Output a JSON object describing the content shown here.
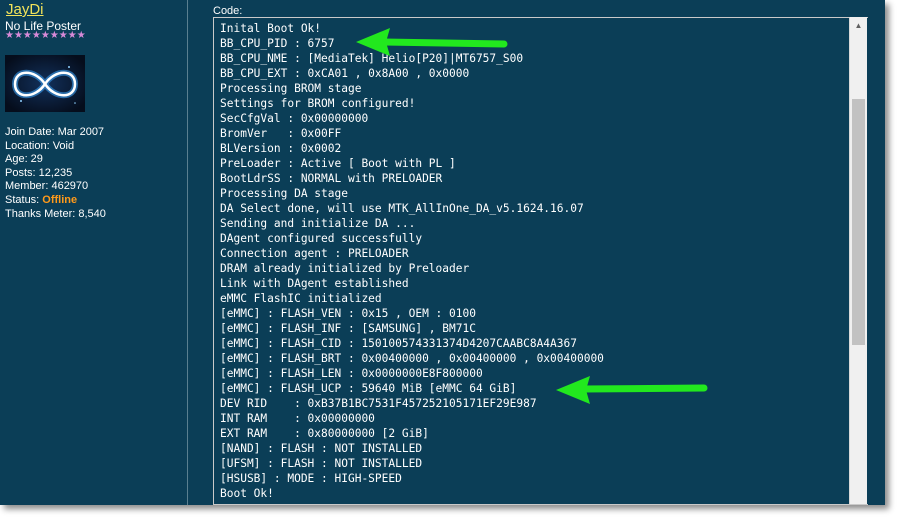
{
  "user": {
    "username": "JayDi",
    "rank": "No Life Poster",
    "stars": "★★★★★★★★★",
    "join_date": "Join Date: Mar 2007",
    "location": "Location: Void",
    "age": "Age: 29",
    "posts": "Posts: 12,235",
    "member": "Member: 462970",
    "status_label": "Status: ",
    "status_value": "Offline",
    "thanks": "Thanks Meter: 8,540"
  },
  "code": {
    "label": "Code:",
    "lines": [
      "Inital Boot Ok!",
      "BB_CPU_PID : 6757",
      "BB_CPU_NME : [MediaTek] Helio[P20]|MT6757_S00",
      "BB_CPU_EXT : 0xCA01 , 0x8A00 , 0x0000",
      "Processing BROM stage",
      "Settings for BROM configured!",
      "SecCfgVal : 0x00000000",
      "BromVer   : 0x00FF",
      "BLVersion : 0x0002",
      "PreLoader : Active [ Boot with PL ]",
      "BootLdrSS : NORMAL with PRELOADER",
      "Processing DA stage",
      "DA Select done, will use MTK_AllInOne_DA_v5.1624.16.07",
      "Sending and initialize DA ...",
      "DAgent configured successfully",
      "Connection agent : PRELOADER",
      "DRAM already initialized by Preloader",
      "Link with DAgent established",
      "eMMC FlashIC initialized",
      "[eMMC] : FLASH_VEN : 0x15 , OEM : 0100",
      "[eMMC] : FLASH_INF : [SAMSUNG] , BM71C",
      "[eMMC] : FLASH_CID : 150100574331374D4207CAABC8A4A367",
      "[eMMC] : FLASH_BRT : 0x00400000 , 0x00400000 , 0x00400000",
      "[eMMC] : FLASH_LEN : 0x0000000E8F800000",
      "[eMMC] : FLASH_UCP : 59640 MiB [eMMC 64 GiB]",
      "DEV RID    : 0xB37B1BC7531F457252105171EF29E987",
      "INT RAM    : 0x00000000",
      "EXT RAM    : 0x80000000 [2 GiB]",
      "[NAND] : FLASH : NOT INSTALLED",
      "[UFSM] : FLASH : NOT INSTALLED",
      "[HSUSB] : MODE : HIGH-SPEED",
      "Boot Ok!"
    ]
  },
  "colors": {
    "background": "#0b3e57",
    "username": "#f2e35a",
    "offline": "#ff9a1a",
    "arrow": "#22e81e",
    "stars": "#d88ad8"
  },
  "icons": {
    "scroll_up": "triangle-up",
    "annotation": "green-arrow-left"
  }
}
